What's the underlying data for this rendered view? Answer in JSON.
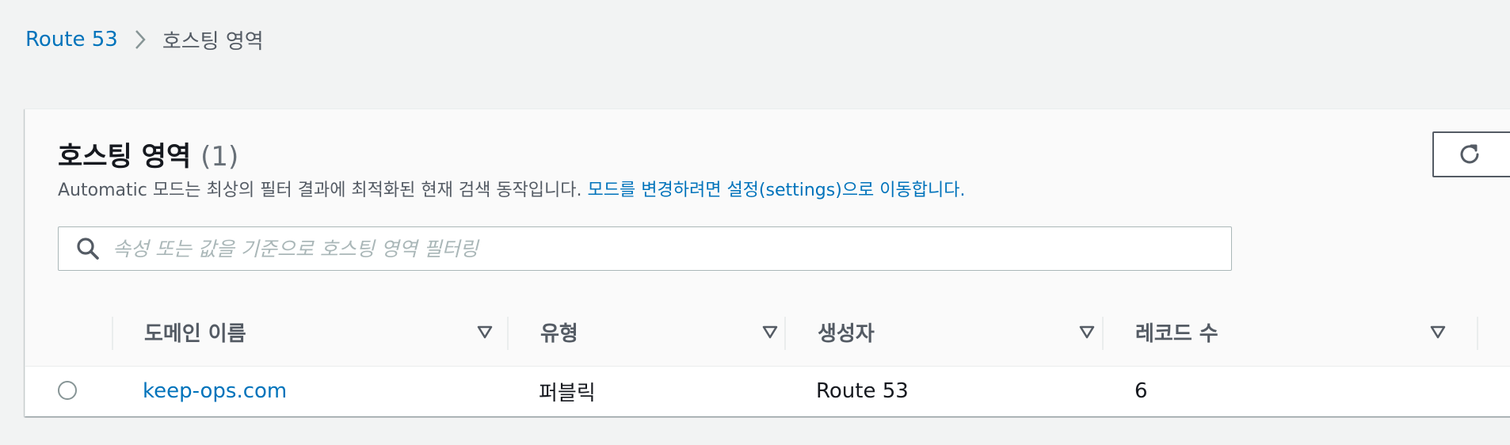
{
  "breadcrumb": {
    "root": "Route 53",
    "current": "호스팅 영역"
  },
  "panel": {
    "title": "호스팅 영역",
    "count": "(1)",
    "description_text": "Automatic 모드는 최상의 필터 결과에 최적화된 현재 검색 동작입니다. ",
    "description_link": "모드를 변경하려면 설정(settings)으로 이동합니다.",
    "refresh_icon": "refresh-icon"
  },
  "search": {
    "placeholder": "속성 또는 값을 기준으로 호스팅 영역 필터링",
    "value": "",
    "icon": "search-icon"
  },
  "table": {
    "columns": [
      {
        "label": "도메인 이름"
      },
      {
        "label": "유형"
      },
      {
        "label": "생성자"
      },
      {
        "label": "레코드 수"
      }
    ],
    "rows": [
      {
        "domain": "keep-ops.com",
        "type": "퍼블릭",
        "created_by": "Route 53",
        "record_count": "6",
        "selected": false
      }
    ]
  },
  "colors": {
    "link": "#0073bb",
    "background": "#f2f3f3",
    "header_text": "#545b64"
  }
}
